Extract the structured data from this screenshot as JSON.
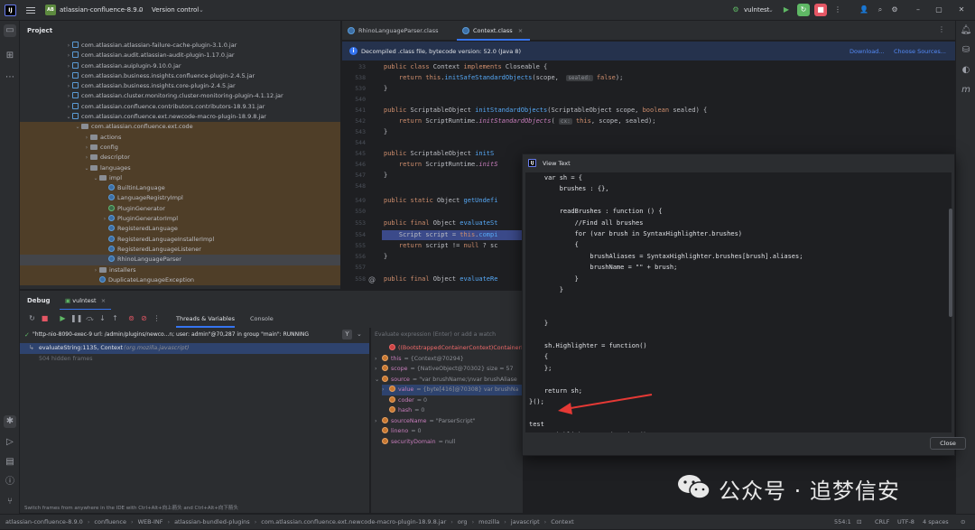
{
  "titlebar": {
    "project_badge": "AB",
    "project_name": "atlassian-confluence-8.9.0",
    "vcs": "Version control",
    "run_config": "vulntest"
  },
  "project_panel": {
    "title": "Project",
    "tree": [
      {
        "label": "com.atlassian.atlassian-failure-cache-plugin-3.1.0.jar",
        "indent": 4,
        "icon": "jar",
        "arrow": "›"
      },
      {
        "label": "com.atlassian.audit.atlassian-audit-plugin-1.17.0.jar",
        "indent": 4,
        "icon": "jar",
        "arrow": "›"
      },
      {
        "label": "com.atlassian.auiplugin-9.10.0.jar",
        "indent": 4,
        "icon": "jar",
        "arrow": "›"
      },
      {
        "label": "com.atlassian.business.insights.confluence-plugin-2.4.5.jar",
        "indent": 4,
        "icon": "jar",
        "arrow": "›"
      },
      {
        "label": "com.atlassian.business.insights.core-plugin-2.4.5.jar",
        "indent": 4,
        "icon": "jar",
        "arrow": "›"
      },
      {
        "label": "com.atlassian.cluster.monitoring.cluster-monitoring-plugin-4.1.12.jar",
        "indent": 4,
        "icon": "jar",
        "arrow": "›"
      },
      {
        "label": "com.atlassian.confluence.contributors.contributors-18.9.31.jar",
        "indent": 4,
        "icon": "jar",
        "arrow": "›"
      },
      {
        "label": "com.atlassian.confluence.ext.newcode-macro-plugin-18.9.8.jar",
        "indent": 4,
        "icon": "jar",
        "arrow": "⌄"
      },
      {
        "label": "com.atlassian.confluence.ext.code",
        "indent": 5,
        "icon": "folder",
        "arrow": "⌄",
        "hl": true
      },
      {
        "label": "actions",
        "indent": 6,
        "icon": "folder",
        "arrow": "›",
        "hl": true
      },
      {
        "label": "config",
        "indent": 6,
        "icon": "folder",
        "arrow": "›",
        "hl": true
      },
      {
        "label": "descriptor",
        "indent": 6,
        "icon": "folder",
        "arrow": "›",
        "hl": true
      },
      {
        "label": "languages",
        "indent": 6,
        "icon": "folder",
        "arrow": "⌄",
        "hl": true
      },
      {
        "label": "impl",
        "indent": 7,
        "icon": "folder",
        "arrow": "⌄",
        "hl": true
      },
      {
        "label": "BuiltinLanguage",
        "indent": 8,
        "icon": "cls",
        "arrow": "",
        "hl": true
      },
      {
        "label": "LanguageRegistryImpl",
        "indent": 8,
        "icon": "cls",
        "arrow": "",
        "hl": true
      },
      {
        "label": "PluginGenerator",
        "indent": 8,
        "icon": "ifc",
        "arrow": "",
        "hl": true
      },
      {
        "label": "PluginGeneratorImpl",
        "indent": 8,
        "icon": "cls",
        "arrow": "›",
        "hl": true
      },
      {
        "label": "RegisteredLanguage",
        "indent": 8,
        "icon": "cls",
        "arrow": "",
        "hl": true
      },
      {
        "label": "RegisteredLanguageInstallerImpl",
        "indent": 8,
        "icon": "cls",
        "arrow": "",
        "hl": true
      },
      {
        "label": "RegisteredLanguageListener",
        "indent": 8,
        "icon": "cls",
        "arrow": "",
        "hl": true
      },
      {
        "label": "RhinoLanguageParser",
        "indent": 8,
        "icon": "cls",
        "arrow": "",
        "sel": true
      },
      {
        "label": "installers",
        "indent": 7,
        "icon": "folder",
        "arrow": "›",
        "hl": true
      },
      {
        "label": "DuplicateLanguageException",
        "indent": 7,
        "icon": "cls",
        "arrow": "",
        "hl": true
      }
    ]
  },
  "editor": {
    "tabs": [
      {
        "label": "RhinoLanguageParser.class",
        "active": false
      },
      {
        "label": "Context.class",
        "active": true
      }
    ],
    "banner": {
      "text": "Decompiled .class file, bytecode version: 52.0 (Java 8)",
      "download": "Download...",
      "choose": "Choose Sources..."
    },
    "lines": [
      {
        "n": "33",
        "html": "<span class=\"kw\">public class</span> Context <span class=\"kw\">implements</span> Closeable {"
      },
      {
        "n": "538",
        "html": "    <span class=\"kw\">return this</span>.<span class=\"fn\">initSafeStandardObjects</span>(scope,  <span class=\"hint\">sealed:</span> <span class=\"kw\">false</span>);"
      },
      {
        "n": "539",
        "html": "}"
      },
      {
        "n": "540",
        "html": ""
      },
      {
        "n": "541",
        "html": "<span class=\"kw\">public</span> ScriptableObject <span class=\"fn\">initStandardObjects</span>(ScriptableObject scope, <span class=\"kw\">boolean</span> sealed) {"
      },
      {
        "n": "542",
        "html": "    <span class=\"kw\">return</span> ScriptRuntime.<span class=\"it\">initStandardObjects</span>( <span class=\"hint\">cx:</span> <span class=\"kw\">this</span>, scope, sealed);"
      },
      {
        "n": "543",
        "html": "}"
      },
      {
        "n": "544",
        "html": ""
      },
      {
        "n": "545",
        "html": "<span class=\"kw\">public</span> ScriptableObject <span class=\"fn\">initS</span>"
      },
      {
        "n": "546",
        "html": "    <span class=\"kw\">return</span> ScriptRuntime.<span class=\"it\">initS</span>"
      },
      {
        "n": "547",
        "html": "}"
      },
      {
        "n": "548",
        "html": ""
      },
      {
        "n": "549",
        "html": "<span class=\"kw\">public static</span> Object <span class=\"fn\">getUndefi</span>"
      },
      {
        "n": "550",
        "html": ""
      },
      {
        "n": "553",
        "html": "<span class=\"kw\">public final</span> Object <span class=\"fn\">evaluateSt</span>"
      },
      {
        "n": "554",
        "html": "    Script script = <span class=\"kw\">this</span>.<span class=\"fn\">compi</span>"
      },
      {
        "n": "555",
        "html": "    <span class=\"kw\">return</span> script != <span class=\"kw\">null</span> ? sc"
      },
      {
        "n": "556",
        "html": "}"
      },
      {
        "n": "557",
        "html": ""
      },
      {
        "n": "558",
        "html": "<span class=\"kw\">public final</span> Object <span class=\"fn\">evaluateRe</span>"
      }
    ]
  },
  "debug": {
    "title": "Debug",
    "session": "vulntest",
    "tabs": [
      "Threads & Variables",
      "Console"
    ],
    "thread": "\"http-nio-8090-exec-9 url: /admin/plugins/newco...n; user: admin\"@70,287 in group \"main\": RUNNING",
    "frame": "evaluateString:1135, Context",
    "frame_pkg": "(org.mozilla.javascript)",
    "hidden": "504 hidden frames",
    "eval_placeholder": "Evaluate expression (Enter) or add a watch",
    "vars": [
      {
        "indent": 1,
        "arrow": "",
        "icon": "red",
        "text": "((BootstrappedContainerContext)ContainerI",
        "red": true
      },
      {
        "indent": 0,
        "arrow": "›",
        "icon": "orange",
        "name": "this",
        "val": "= {Context@70294}"
      },
      {
        "indent": 0,
        "arrow": "›",
        "icon": "orange",
        "name": "scope",
        "val": "= {NativeObject@70302}  size = 57"
      },
      {
        "indent": 0,
        "arrow": "⌄",
        "icon": "orange",
        "name": "source",
        "val": "= \"var brushName;\\nvar brushAliase"
      },
      {
        "indent": 1,
        "arrow": "›",
        "icon": "orange",
        "name": "value",
        "val": "= {byte[416]@70308} var brushNa",
        "sel": true
      },
      {
        "indent": 1,
        "arrow": "",
        "icon": "orange",
        "name": "coder",
        "val": "= 0"
      },
      {
        "indent": 1,
        "arrow": "",
        "icon": "orange",
        "name": "hash",
        "val": "= 0"
      },
      {
        "indent": 0,
        "arrow": "›",
        "icon": "orange",
        "name": "sourceName",
        "val": "= \"ParserScript\""
      },
      {
        "indent": 0,
        "arrow": "",
        "icon": "orange",
        "name": "lineno",
        "val": "= 0"
      },
      {
        "indent": 0,
        "arrow": "",
        "icon": "orange",
        "name": "securityDomain",
        "val": "= null"
      }
    ]
  },
  "dialog": {
    "title": "View Text",
    "lines": [
      "    var sh = {",
      "        brushes : {},",
      "",
      "        readBrushes : function () {",
      "            //Find all brushes",
      "            for (var brush in SyntaxHighlighter.brushes)",
      "            {",
      "                brushAliases = SyntaxHighlighter.brushes[brush].aliases;",
      "                brushName = \"\" + brush;",
      "            }",
      "        }",
      "",
      "",
      "    }",
      "",
      "    sh.Highlighter = function()",
      "    {",
      "    };",
      "",
      "    return sh;",
      "}();",
      "",
      "test",
      "SyntaxHighlighter.readBrushes();"
    ],
    "close": "Close"
  },
  "statusbar": {
    "breadcrumbs": [
      "atlassian-confluence-8.9.0",
      "confluence",
      "WEB-INF",
      "atlassian-bundled-plugins",
      "com.atlassian.confluence.ext.newcode-macro-plugin-18.9.8.jar",
      "org",
      "mozilla",
      "javascript",
      "Context"
    ],
    "position": "554:1",
    "line_sep": "CRLF",
    "encoding": "UTF-8",
    "indent": "4 spaces",
    "hint": "Switch frames from anywhere in the IDE with Ctrl+Alt+向上箭头 and Ctrl+Alt+向下箭头"
  },
  "watermark": {
    "text": "公众号 · 追梦信安"
  },
  "colors": {
    "accent": "#3574f0",
    "run_green": "#5fb865",
    "stop_red": "#e55765",
    "arrow_red": "#e53935"
  }
}
